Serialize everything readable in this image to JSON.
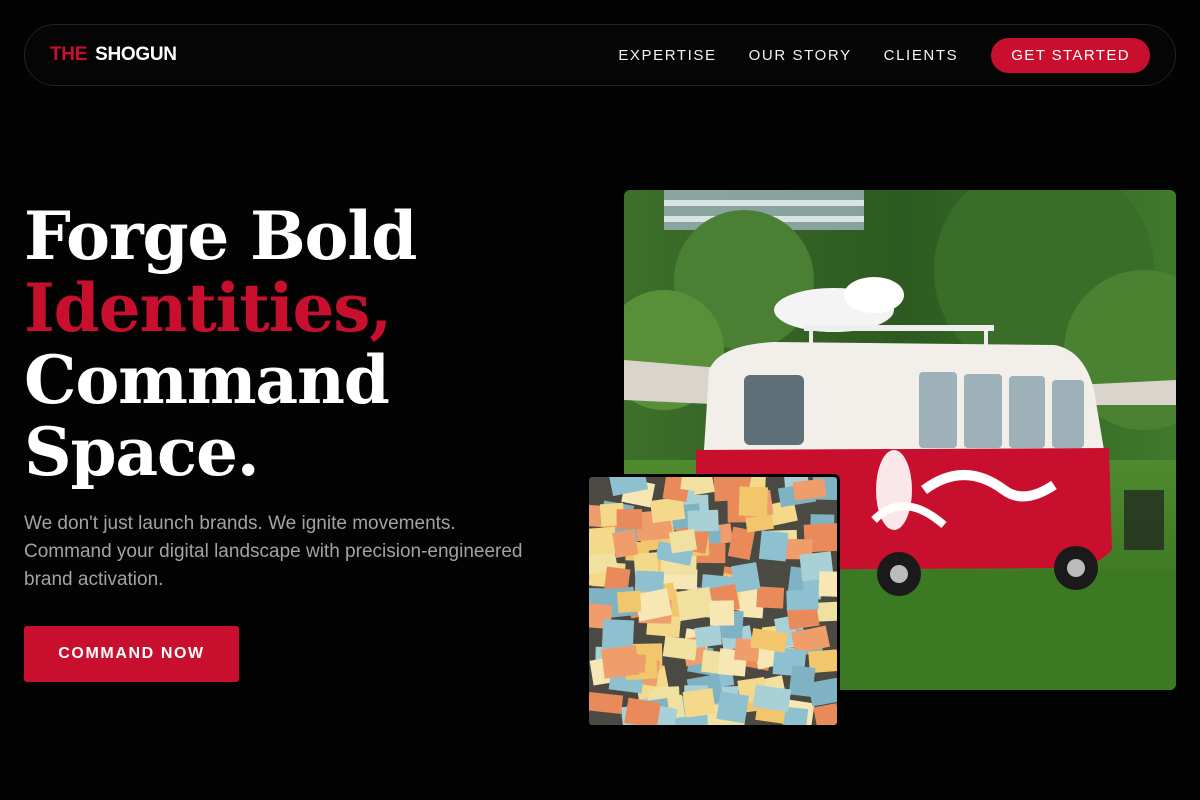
{
  "nav": {
    "logo_prefix": "THE",
    "logo_main": "SHOGUN",
    "links": [
      "EXPERTISE",
      "OUR STORY",
      "CLIENTS"
    ],
    "cta": "GET STARTED"
  },
  "hero": {
    "headline_lines": [
      "Forge Bold",
      "Identities,",
      "Command",
      "Space."
    ],
    "subtext": "We don't just launch brands. We ignite movements. Command your digital landscape with precision-engineered brand activation.",
    "button": "COMMAND NOW"
  },
  "images": {
    "main": "photo-red-van",
    "secondary": "photo-sticky-notes-wall"
  },
  "colors": {
    "accent": "#c8102e",
    "background": "#030303",
    "text": "#ffffff",
    "muted": "#a3a3a3"
  }
}
